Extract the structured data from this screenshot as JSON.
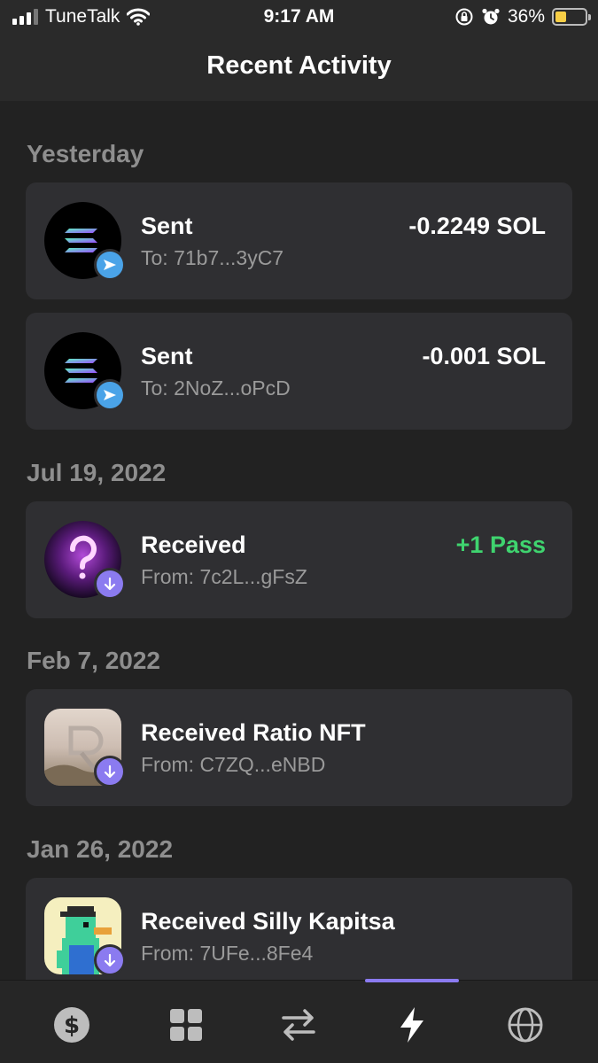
{
  "status_bar": {
    "carrier": "TuneTalk",
    "time": "9:17 AM",
    "battery_percent": "36%",
    "battery_level": 0.36
  },
  "header": {
    "title": "Recent Activity"
  },
  "sections": [
    {
      "title": "Yesterday",
      "items": [
        {
          "title": "Sent",
          "subtitle": "To: 71b7...3yC7",
          "amount": "-0.2249 SOL",
          "icon": "solana-logo-icon",
          "badge": "send-icon"
        },
        {
          "title": "Sent",
          "subtitle": "To: 2NoZ...oPcD",
          "amount": "-0.001 SOL",
          "icon": "solana-logo-icon",
          "badge": "send-icon"
        }
      ]
    },
    {
      "title": "Jul 19, 2022",
      "items": [
        {
          "title": "Received",
          "subtitle": "From: 7c2L...gFsZ",
          "amount": "+1 Pass",
          "icon": "question-mark-nft-icon",
          "badge": "arrow-down-icon"
        }
      ]
    },
    {
      "title": "Feb 7, 2022",
      "items": [
        {
          "title": "Received Ratio NFT",
          "subtitle": "From: C7ZQ...eNBD",
          "icon": "ratio-nft-image",
          "badge": "arrow-down-icon"
        }
      ]
    },
    {
      "title": "Jan 26, 2022",
      "items": [
        {
          "title": "Received Silly Kapitsa",
          "subtitle": "From: 7UFe...8Fe4",
          "icon": "pixel-duck-nft-image",
          "badge": "arrow-down-icon"
        }
      ]
    }
  ],
  "tabs": [
    {
      "name": "dollar-icon"
    },
    {
      "name": "grid-icon"
    },
    {
      "name": "swap-icon"
    },
    {
      "name": "lightning-icon",
      "active": true
    },
    {
      "name": "globe-icon"
    }
  ],
  "colors": {
    "background": "#222222",
    "card": "#2f2f32",
    "positive": "#3fd46f",
    "accent": "#8b7bf0",
    "send_badge": "#4aa3e8"
  }
}
